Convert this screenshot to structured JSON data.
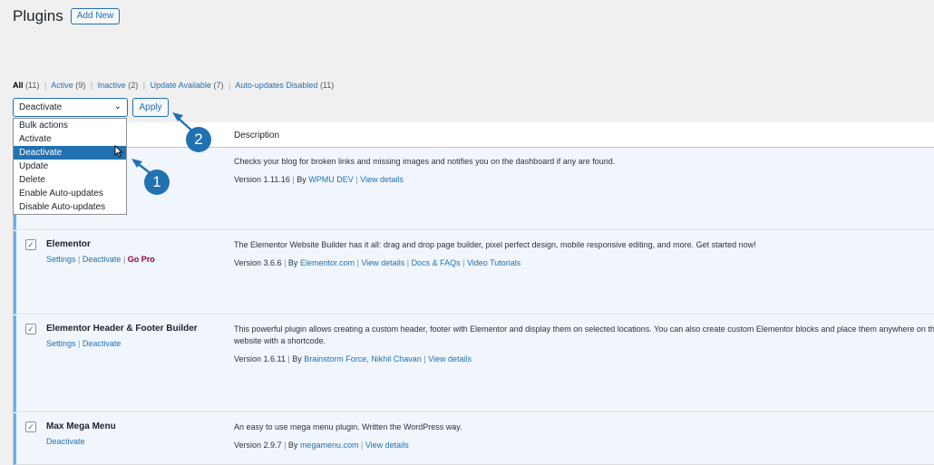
{
  "header": {
    "title": "Plugins",
    "add_new_label": "Add New"
  },
  "filters": {
    "all": "All",
    "all_count": "(11)",
    "active": "Active",
    "active_count": "(9)",
    "inactive": "Inactive",
    "inactive_count": "(2)",
    "update": "Update Available",
    "update_count": "(7)",
    "autoupd": "Auto-updates Disabled",
    "autoupd_count": "(11)"
  },
  "bulk": {
    "selected": "Deactivate",
    "apply_label": "Apply",
    "options": [
      "Bulk actions",
      "Activate",
      "Deactivate",
      "Update",
      "Delete",
      "Enable Auto-updates",
      "Disable Auto-updates"
    ]
  },
  "table": {
    "description_header": "Description"
  },
  "plugins": [
    {
      "desc": "Checks your blog for broken links and missing images and notifies you on the dashboard if any are found.",
      "version": "Version 1.11.16",
      "by": "By",
      "author": "WPMU DEV",
      "view": "View details"
    },
    {
      "name": "Elementor",
      "a1": "Settings",
      "a2": "Deactivate",
      "a3": "Go Pro",
      "desc": "The Elementor Website Builder has it all: drag and drop page builder, pixel perfect design, mobile responsive editing, and more. Get started now!",
      "version": "Version 3.6.6",
      "by": "By",
      "author": "Elementor.com",
      "view": "View details",
      "docs": "Docs & FAQs",
      "video": "Video Tutorials"
    },
    {
      "name": "Elementor Header & Footer Builder",
      "a1": "Settings",
      "a2": "Deactivate",
      "desc": "This powerful plugin allows creating a custom header, footer with Elementor and display them on selected locations. You can also create custom Elementor blocks and place them anywhere on the website with a shortcode.",
      "version": "Version 1.6.11",
      "by": "By",
      "author": "Brainstorm Force, Nikhil Chavan",
      "view": "View details"
    },
    {
      "name": "Max Mega Menu",
      "a1": "Deactivate",
      "desc": "An easy to use mega menu plugin. Written the WordPress way.",
      "version": "Version 2.9.7",
      "by": "By",
      "author": "megamenu.com",
      "view": "View details"
    }
  ],
  "annotations": {
    "badge1": "1",
    "badge2": "2"
  },
  "colors": {
    "accent": "#2271b1",
    "row_highlight": "#f0f6fc",
    "gopro": "#93003c"
  }
}
